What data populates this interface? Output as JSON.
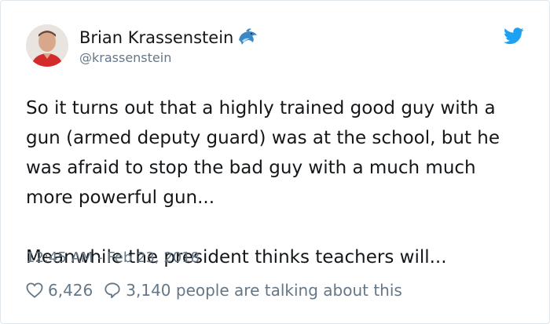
{
  "user": {
    "display_name": "Brian Krassenstein",
    "handle": "@krassenstein"
  },
  "tweet": {
    "text": "So it turns out that a highly trained good guy with a\ngun (armed deputy guard) was at the school, but he\nwas afraid to stop the bad guy with a much much\nmore powerful gun...\n\nMeanwhile the president thinks teachers will...",
    "timestamp": "12:45 AM - Feb 23, 2018"
  },
  "engagement": {
    "likes": "6,426",
    "replies_text": "3,140 people are talking about this"
  },
  "colors": {
    "twitter_blue": "#1da1f2",
    "secondary_text": "#657786",
    "primary_text": "#14171a",
    "border": "#e1e8ed"
  },
  "icons": {
    "verified_badge": "dolphin-emoji-icon",
    "brand": "twitter-bird-icon",
    "like": "heart-outline-icon",
    "reply": "speech-bubble-icon"
  }
}
